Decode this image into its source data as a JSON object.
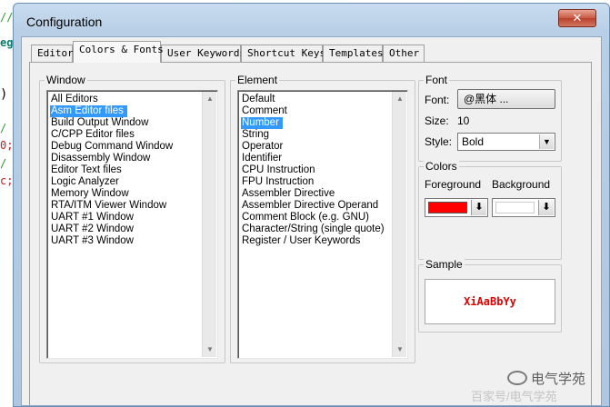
{
  "background_editor": {
    "fragments": [
      {
        "text": "//",
        "cls": "green"
      },
      {
        "text": "eg.",
        "cls": "teal"
      },
      {
        "text": ")",
        "cls": ""
      },
      {
        "text": "/",
        "cls": "green"
      },
      {
        "text": "0;",
        "cls": "red"
      },
      {
        "text": "/",
        "cls": "green"
      },
      {
        "text": "c;",
        "cls": "red"
      }
    ]
  },
  "dialog": {
    "title": "Configuration",
    "close_symbol": "✕",
    "tabs": [
      "Editor",
      "Colors & Fonts",
      "User Keywords",
      "Shortcut Keys",
      "Templates",
      "Other"
    ],
    "active_tab": 1
  },
  "window_group": {
    "label": "Window",
    "items": [
      "All Editors",
      "Asm Editor files",
      "Build Output Window",
      "C/CPP Editor files",
      "Debug Command Window",
      "Disassembly Window",
      "Editor Text files",
      "Logic Analyzer",
      "Memory Window",
      "RTA/ITM Viewer Window",
      "UART #1 Window",
      "UART #2 Window",
      "UART #3 Window"
    ],
    "selected": 1
  },
  "element_group": {
    "label": "Element",
    "items": [
      "Default",
      "Comment",
      "Number",
      "String",
      "Operator",
      "Identifier",
      "CPU Instruction",
      "FPU Instruction",
      "Assembler Directive",
      "Assembler Directive Operand",
      "Comment Block (e.g. GNU)",
      "Character/String (single quote)",
      "Register / User Keywords"
    ],
    "selected": 2
  },
  "font_group": {
    "label": "Font",
    "font_label": "Font:",
    "font_value": "@黑体 ...",
    "size_label": "Size:",
    "size_value": "10",
    "style_label": "Style:",
    "style_value": "Bold"
  },
  "colors_group": {
    "label": "Colors",
    "foreground_label": "Foreground",
    "background_label": "Background",
    "foreground_color": "#ff0000",
    "background_color": "#ffffff",
    "picker_symbol": "⬇"
  },
  "sample_group": {
    "label": "Sample",
    "text": "XiAaBbYy",
    "color": "#e00000"
  },
  "watermark": {
    "text": "电气学苑",
    "sub": "百家号/电气学苑"
  },
  "icons": {
    "scroll_up": "up-arrow-icon",
    "scroll_down": "down-arrow-icon",
    "combo": "chevron-down-icon",
    "title": "window-icon"
  }
}
